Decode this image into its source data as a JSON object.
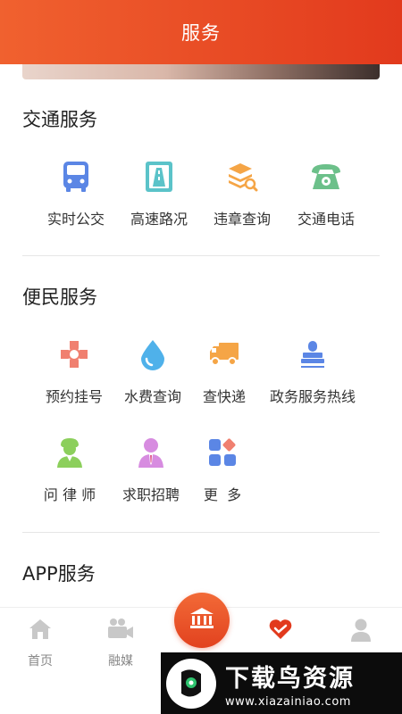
{
  "header": {
    "title": "服务"
  },
  "traffic": {
    "title": "交通服务",
    "items": [
      {
        "label": "实时公交",
        "icon": "bus-icon"
      },
      {
        "label": "高速路况",
        "icon": "highway-icon"
      },
      {
        "label": "违章查询",
        "icon": "violation-search-icon"
      },
      {
        "label": "交通电话",
        "icon": "phone-icon"
      }
    ]
  },
  "convenience": {
    "title": "便民服务",
    "items": [
      {
        "label": "预约挂号",
        "icon": "medical-cross-icon"
      },
      {
        "label": "水费查询",
        "icon": "water-drop-icon"
      },
      {
        "label": "查快递",
        "icon": "delivery-truck-icon"
      },
      {
        "label": "政务服务热线",
        "icon": "stamp-icon"
      },
      {
        "label": "问 律 师",
        "icon": "lawyer-icon"
      },
      {
        "label": "求职招聘",
        "icon": "job-seeker-icon"
      },
      {
        "label": "更  多",
        "icon": "more-grid-icon"
      }
    ]
  },
  "app": {
    "title": "APP服务"
  },
  "tabbar": {
    "home": "首页",
    "media": "融媒",
    "center_icon": "government-building-icon",
    "favorite_icon": "heart-icon",
    "profile_icon": "user-icon"
  },
  "watermark": {
    "main": "下载鸟资源",
    "sub": "www.xiazainiao.com"
  },
  "colors": {
    "brand": "#e84a24",
    "blue": "#5b86e5",
    "teal": "#5bc3c9",
    "orange": "#f5a546",
    "green": "#6cc08a",
    "pink": "#f08070"
  }
}
